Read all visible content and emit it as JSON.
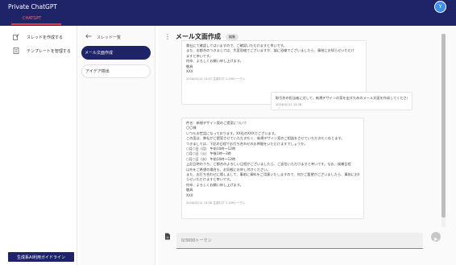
{
  "app": {
    "title": "Private ChatGPT",
    "avatar_initial": "Y"
  },
  "tabs": [
    {
      "label": "CHATGPT"
    }
  ],
  "colors": {
    "primary": "#1f2368",
    "accent": "#e23b4e",
    "avatar": "#3f8ee8"
  },
  "left_menu": {
    "items": [
      {
        "label": "スレッドを作成する",
        "icon": "new-thread-icon"
      },
      {
        "label": "テンプレートを管理する",
        "icon": "template-icon"
      }
    ],
    "guide_button": "生成系AI利用ガイドライン"
  },
  "thread_panel": {
    "back_label": "スレッド一覧",
    "items": [
      {
        "label": "メール文面作成",
        "active": true
      },
      {
        "label": "アイデア検出",
        "active": false
      }
    ]
  },
  "chat": {
    "title": "メール文面作成",
    "badge": "編集",
    "messages": [
      {
        "role": "assistant",
        "lines": [
          "貴社にて確認してはいますので、ご確認いただけますと幸いです。",
          "また、お都合のつきましては、大変恐縮でございますが、誠に恐縮でございましたら、事前にお知らせいただけ",
          "ますと幸いです。",
          "何卒、よろしくお願い申し上げます。",
          "敬具",
          "XXX"
        ],
        "meta": "2024/01/11 13:27 生成ログ 1,190トークン"
      },
      {
        "role": "user",
        "lines": [
          "取引先の担当者に対して、新規デザインの案を出すためのメール文面を作成してください。"
        ],
        "meta": "2024/01/11 13:28"
      },
      {
        "role": "assistant",
        "lines": [
          "件名：新規デザイン案のご提案について",
          "〇〇様",
          "いつもお世話になっております。XX社のXXXでございます。",
          "この度は、弊社がご提案させていただきたく、新規デザイン案のご相談をさせていただきたく存じます。",
          "つきましては、下記の日程でお打ち合わせのお時間をいただけますでしょうか。",
          "○月○日（月） 午前10時～12時",
          "○月○日（火） 午後1時～3時",
          "○月○日（水） 午前10時～12時",
          "上記日時のうち、ご都合のよろしい日程がございましたら、ご返信いただけますと幸いです。なお、候補日程",
          "以外をご希望の場合も、お気軽にお申し付けください。",
          "また、お打ち合わせに際しまして、事前に資料をご用意いたしますので、何かご要望がございましたら、事前にお知",
          "らせいただけますと幸いです。",
          "何卒、よろしくお願い申し上げます。",
          "敬具",
          "XXX"
        ],
        "meta": "2024/01/11 13:28 生成ログ 1,109トークン"
      }
    ],
    "input_placeholder": "0/3000トークン"
  }
}
